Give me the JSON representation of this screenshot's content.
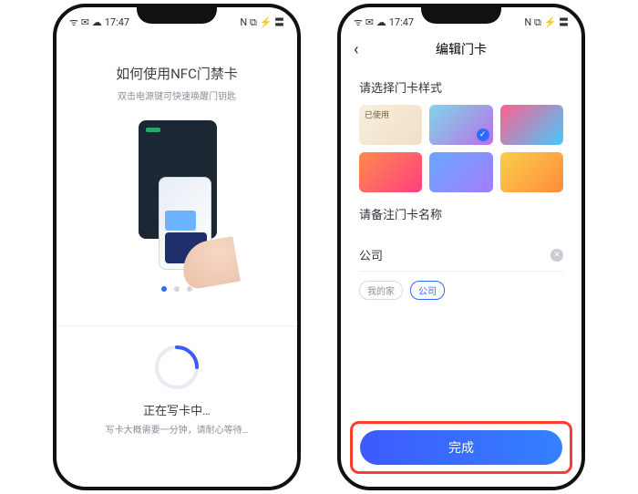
{
  "statusbar": {
    "time": "17:47",
    "icons_left": "ᯤ ✉ ☁",
    "icons_right": "N ⧉ ⚡ 〓"
  },
  "phone1": {
    "title": "如何使用NFC门禁卡",
    "subtitle": "双击电源键可快速唤醒门钥匙",
    "dots": 3,
    "active_dot": 0,
    "writing": "正在写卡中…",
    "writing_note": "写卡大概需要一分钟，请耐心等待…"
  },
  "phone2": {
    "header_title": "编辑门卡",
    "section_style": "请选择门卡样式",
    "swatches": [
      {
        "id": "A",
        "tag": "已使用",
        "selected": false
      },
      {
        "id": "B",
        "tag": "",
        "selected": true
      },
      {
        "id": "C",
        "tag": "",
        "selected": false
      },
      {
        "id": "D",
        "tag": "",
        "selected": false
      },
      {
        "id": "E",
        "tag": "",
        "selected": false
      },
      {
        "id": "F",
        "tag": "",
        "selected": false
      }
    ],
    "section_name": "请备注门卡名称",
    "input_value": "公司",
    "chips": [
      {
        "label": "我的家",
        "active": false
      },
      {
        "label": "公司",
        "active": true
      }
    ],
    "done_label": "完成"
  }
}
